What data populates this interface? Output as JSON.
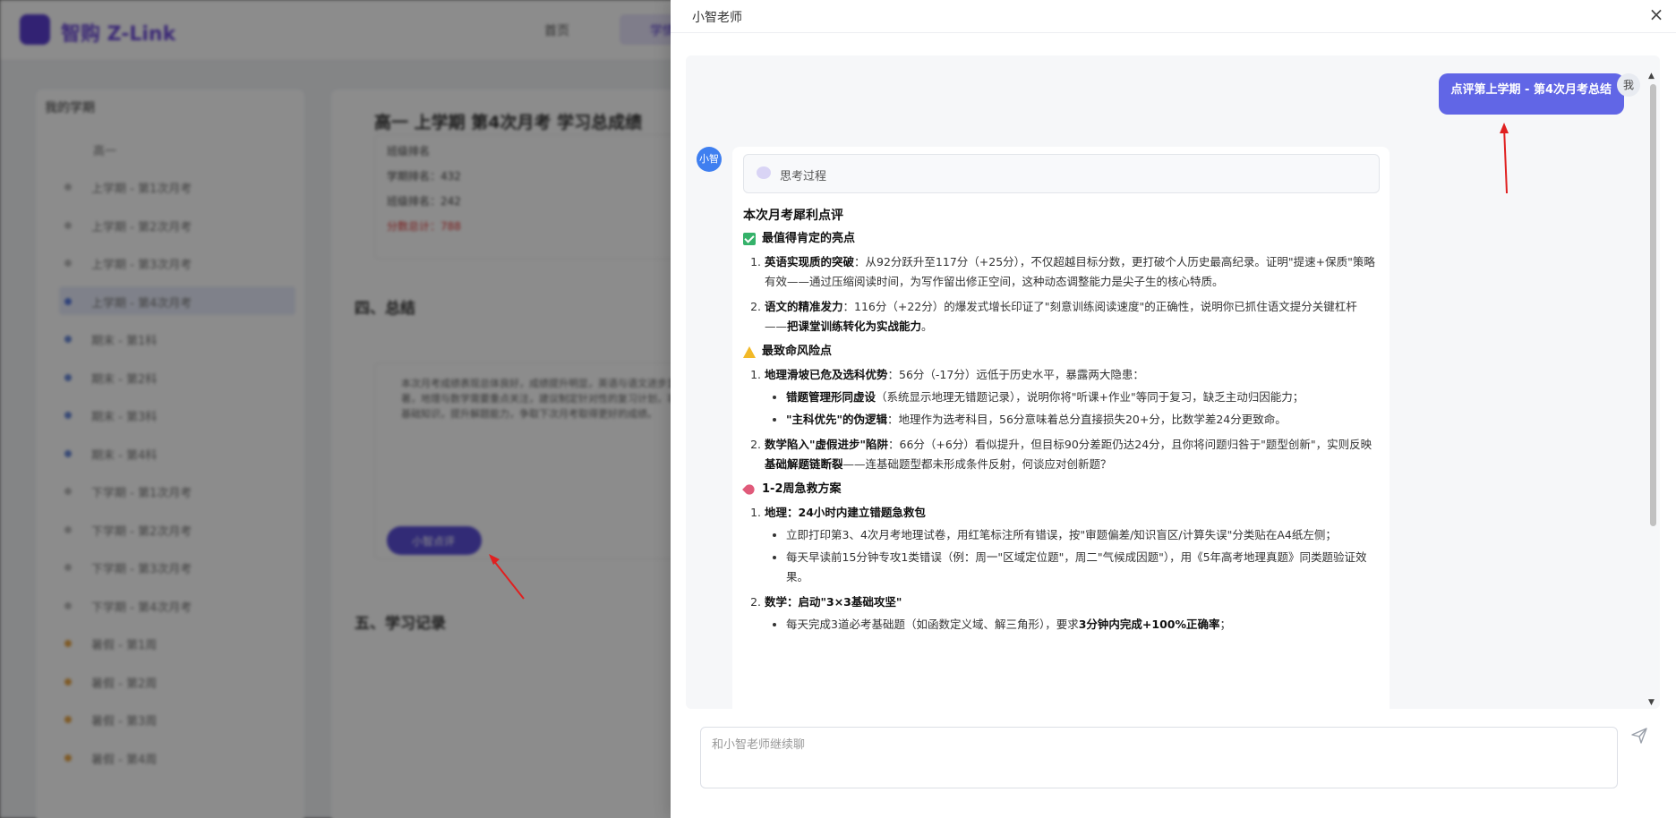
{
  "background": {
    "brand": "智购 Z-Link",
    "nav": [
      "首页",
      "学情"
    ],
    "sidebar_title": "我的学期",
    "sidebar_group": "高一",
    "sidebar_items": [
      "上学期 - 第1次月考",
      "上学期 - 第2次月考",
      "上学期 - 第3次月考",
      "上学期 - 第4次月考",
      "期末 - 第1科",
      "期末 - 第2科",
      "期末 - 第3科",
      "期末 - 第4科",
      "下学期 - 第1次月考",
      "下学期 - 第2次月考",
      "下学期 - 第3次月考",
      "下学期 - 第4次月考",
      "暑假 - 第1周",
      "暑假 - 第2周",
      "暑假 - 第3周",
      "暑假 - 第4周"
    ],
    "main_title": "高一 上学期 第4次月考 学习总成绩",
    "card_lines": [
      "班级排名",
      "学期排名：432",
      "班级排名：242",
      "分数总计：788"
    ],
    "section_4": "四、总结",
    "section_5": "五、学习记录",
    "summary_text": "本次月考成绩表现总体良好，成绩提升明显，英语与语文进步显著，地理与数学需要重点关注，建议制定针对性的复习计划，巩固基础知识，提升解题能力，争取下次月考取得更好的成绩。",
    "ai_button": "小智点评"
  },
  "drawer": {
    "title": "小智老师",
    "close_label": "×"
  },
  "chat": {
    "user_avatar": "我",
    "user_message": "点评第上学期 - 第4次月考总结",
    "ai_avatar": "小智",
    "thinking_label": "思考过程",
    "heading": "本次月考犀利点评",
    "sections": {
      "s1_title": "最值得肯定的亮点",
      "s1_item1_bold": "英语实现质的突破",
      "s1_item1_text": "：从92分跃升至117分（+25分），不仅超越目标分数，更打破个人历史最高纪录。证明\"提速+保质\"策略有效——通过压缩阅读时间，为写作留出修正空间，这种动态调整能力是尖子生的核心特质。",
      "s1_item2_bold": "语文的精准发力",
      "s1_item2_text": "：116分（+22分）的爆发式增长印证了\"刻意训练阅读速度\"的正确性，说明你已抓住语文提分关键杠杆——",
      "s1_item2_bold2": "把课堂训练转化为实战能力",
      "s1_item2_end": "。",
      "s2_title": "最致命风险点",
      "s2_item1_bold": "地理滑坡已危及选科优势",
      "s2_item1_text": "：56分（-17分）远低于历史水平，暴露两大隐患：",
      "s2_sub1_bold": "错题管理形同虚设",
      "s2_sub1_text": "（系统显示地理无错题记录），说明你将\"听课+作业\"等同于复习，缺乏主动归因能力；",
      "s2_sub2_bold": "\"主科优先\"的伪逻辑",
      "s2_sub2_text": "：地理作为选考科目，56分意味着总分直接损失20+分，比数学差24分更致命。",
      "s2_item2_bold": "数学陷入\"虚假进步\"陷阱",
      "s2_item2_text": "：66分（+6分）看似提升，但目标90分差距仍达24分，且你将问题归咎于\"题型创新\"，实则反映",
      "s2_item2_bold2": "基础解题链断裂",
      "s2_item2_end": "——连基础题型都未形成条件反射，何谈应对创新题？",
      "s3_title": "1-2周急救方案",
      "s3_item1_bold": "地理：24小时内建立错题急救包",
      "s3_sub1": "立即打印第3、4次月考地理试卷，用红笔标注所有错误，按\"审题偏差/知识盲区/计算失误\"分类贴在A4纸左侧；",
      "s3_sub2": "每天早读前15分钟专攻1类错误（例：周一\"区域定位题\"，周二\"气候成因题\"），用《5年高考地理真题》同类题验证效果。",
      "s3_item2_bold": "数学：启动\"3×3基础攻坚\"",
      "s3_sub3_text": "每天完成3道必考基础题（如函数定义域、解三角形），要求",
      "s3_sub3_bold": "3分钟内完成+100%正确率",
      "s3_sub3_end": "；"
    }
  },
  "input": {
    "placeholder": "和小智老师继续聊"
  },
  "colors": {
    "user_bubble": "#6166e6",
    "ai_avatar": "#3f7ff0",
    "accent": "#5b3fd1",
    "annotation_arrow": "#e02020"
  }
}
